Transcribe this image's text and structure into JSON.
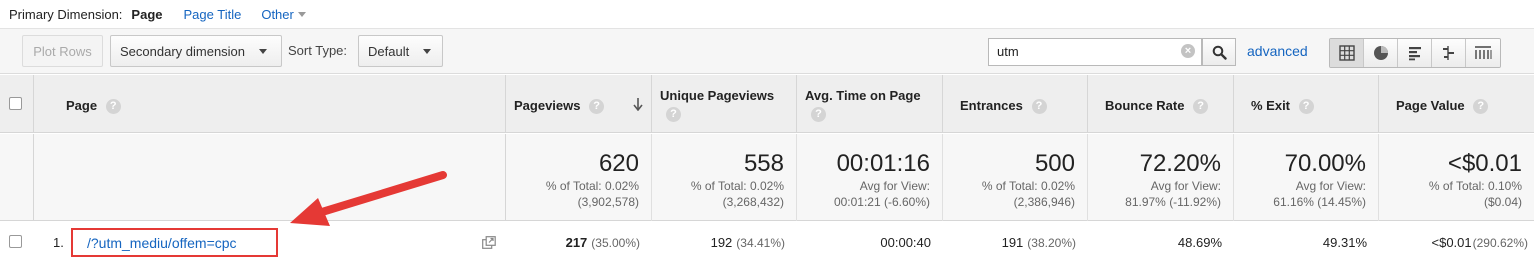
{
  "primary_dimension": {
    "label": "Primary Dimension:",
    "current": "Page",
    "options": [
      "Page Title",
      "Other"
    ]
  },
  "toolbar": {
    "plot_rows": "Plot Rows",
    "secondary_dimension": "Secondary dimension",
    "sort_type_label": "Sort Type:",
    "sort_type_value": "Default",
    "search_value": "utm",
    "advanced": "advanced",
    "views": [
      "table-icon",
      "pie-icon",
      "performance-icon",
      "comparison-icon",
      "pivot-icon"
    ]
  },
  "table": {
    "headers": {
      "page": "Page",
      "pageviews": "Pageviews",
      "unique_pageviews": "Unique Pageviews",
      "avg_time": "Avg. Time on Page",
      "entrances": "Entrances",
      "bounce_rate": "Bounce Rate",
      "exit": "% Exit",
      "page_value": "Page Value"
    },
    "totals": {
      "pageviews": {
        "value": "620",
        "l1": "% of Total: 0.02%",
        "l2": "(3,902,578)"
      },
      "unique_pageviews": {
        "value": "558",
        "l1": "% of Total: 0.02%",
        "l2": "(3,268,432)"
      },
      "avg_time": {
        "value": "00:01:16",
        "l1": "Avg for View:",
        "l2": "00:01:21 (-6.60%)"
      },
      "entrances": {
        "value": "500",
        "l1": "% of Total: 0.02%",
        "l2": "(2,386,946)"
      },
      "bounce_rate": {
        "value": "72.20%",
        "l1": "Avg for View:",
        "l2": "81.97% (-11.92%)"
      },
      "exit": {
        "value": "70.00%",
        "l1": "Avg for View:",
        "l2": "61.16% (14.45%)"
      },
      "page_value": {
        "value": "<$0.01",
        "l1": "% of Total: 0.10%",
        "l2": "($0.04)"
      }
    },
    "rows": [
      {
        "index": "1.",
        "page": "/?utm_mediu/offem=cpc",
        "pageviews": "217",
        "pageviews_pct": "(35.00%)",
        "unique_pageviews": "192",
        "unique_pageviews_pct": "(34.41%)",
        "avg_time": "00:00:40",
        "entrances": "191",
        "entrances_pct": "(38.20%)",
        "bounce_rate": "48.69%",
        "exit": "49.31%",
        "page_value": "<$0.01",
        "page_value_pct": "(290.62%)"
      }
    ]
  },
  "annotation_color": "#e53935",
  "link_color": "#1565c0"
}
